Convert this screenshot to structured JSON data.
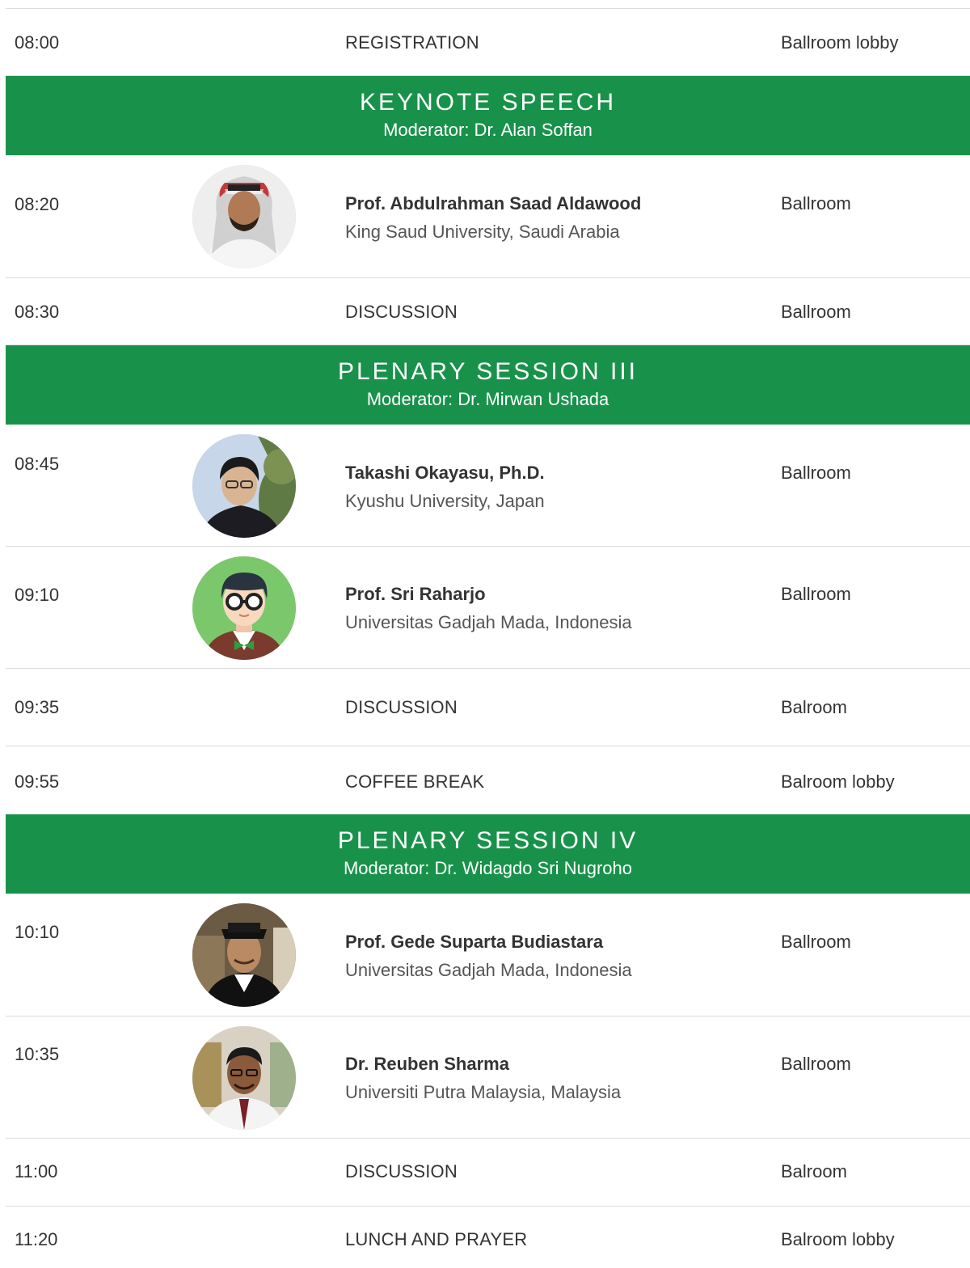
{
  "schedule": {
    "rows": [
      {
        "time": "08:00",
        "title": "REGISTRATION",
        "room": "Ballroom lobby"
      },
      {
        "time": "08:20",
        "speaker": "Prof. Abdulrahman Saad Aldawood",
        "affiliation": "King Saud University, Saudi Arabia",
        "room": "Ballroom"
      },
      {
        "time": "08:30",
        "title": "DISCUSSION",
        "room": "Ballroom"
      },
      {
        "time": "08:45",
        "speaker": "Takashi Okayasu, Ph.D.",
        "affiliation": "Kyushu University, Japan",
        "room": "Ballroom"
      },
      {
        "time": "09:10",
        "speaker": "Prof. Sri Raharjo",
        "affiliation": "Universitas Gadjah Mada, Indonesia",
        "room": "Ballroom"
      },
      {
        "time": "09:35",
        "title": "DISCUSSION",
        "room": "Balroom"
      },
      {
        "time": "09:55",
        "title": "COFFEE BREAK",
        "room": "Balroom lobby"
      },
      {
        "time": "10:10",
        "speaker": "Prof. Gede Suparta Budiastara",
        "affiliation": "Universitas Gadjah Mada, Indonesia",
        "room": "Ballroom"
      },
      {
        "time": "10:35",
        "speaker": "Dr. Reuben Sharma",
        "affiliation": "Universiti Putra Malaysia, Malaysia",
        "room": "Ballroom"
      },
      {
        "time": "11:00",
        "title": "DISCUSSION",
        "room": "Balroom"
      },
      {
        "time": "11:20",
        "title": "LUNCH AND PRAYER",
        "room": "Balroom lobby"
      }
    ],
    "sessions": [
      {
        "title": "KEYNOTE SPEECH",
        "moderator": "Moderator: Dr. Alan Soffan"
      },
      {
        "title": "PLENARY SESSION III",
        "moderator": "Moderator: Dr. Mirwan Ushada"
      },
      {
        "title": "PLENARY SESSION IV",
        "moderator": "Moderator: Dr. Widagdo Sri Nugroho"
      }
    ]
  },
  "colors": {
    "banner": "#18924a",
    "divider": "#dcdcdc",
    "text": "#333333"
  },
  "icons": {
    "speaker_photo": "portrait-photo",
    "illustrated_avatar": "avatar-illustration"
  }
}
